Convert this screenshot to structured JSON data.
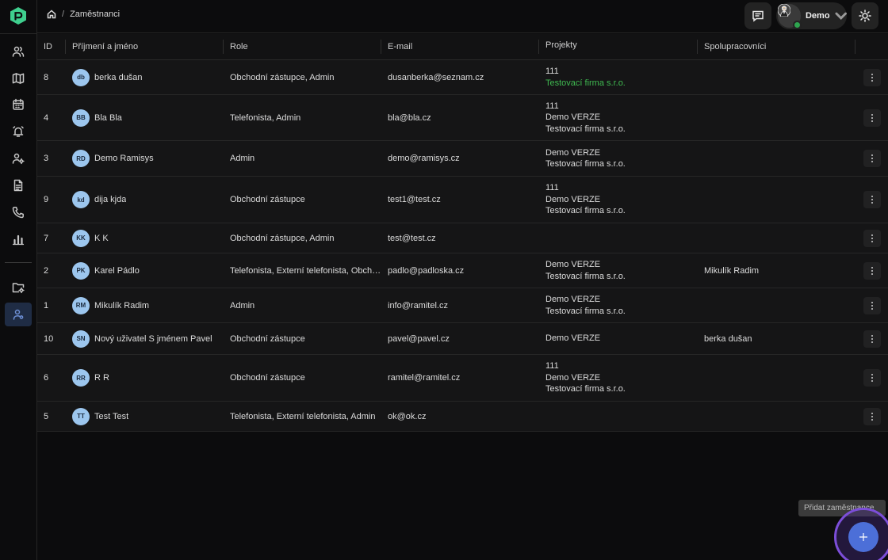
{
  "breadcrumb": {
    "page": "Zaměstnanci",
    "separator": "/"
  },
  "user": {
    "name": "Demo"
  },
  "sidebar": {
    "items": [
      {
        "icon": "users-icon"
      },
      {
        "icon": "map-icon"
      },
      {
        "icon": "calendar-icon"
      },
      {
        "icon": "alarm-icon"
      },
      {
        "icon": "user-cog-icon"
      },
      {
        "icon": "document-icon"
      },
      {
        "icon": "phone-icon"
      },
      {
        "icon": "bar-chart-icon"
      },
      {
        "icon": "folder-settings-icon"
      },
      {
        "icon": "employees-icon",
        "active": true
      }
    ]
  },
  "table": {
    "headers": {
      "id": "ID",
      "name": "Příjmení a jméno",
      "role": "Role",
      "email": "E-mail",
      "projects": "Projekty",
      "collaborators": "Spolupracovníci"
    },
    "rows": [
      {
        "id": "8",
        "initials": "db",
        "name": "berka dušan",
        "role": "Obchodní zástupce, Admin",
        "email": "dusanberka@seznam.cz",
        "projects": [
          "111",
          "Testovací firma s.r.o."
        ],
        "collaborators": ""
      },
      {
        "id": "4",
        "initials": "BB",
        "name": "Bla Bla",
        "role": "Telefonista, Admin",
        "email": "bla@bla.cz",
        "projects": [
          "111",
          "Demo VERZE",
          "Testovací firma s.r.o."
        ],
        "collaborators": ""
      },
      {
        "id": "3",
        "initials": "RD",
        "name": "Demo Ramisys",
        "role": "Admin",
        "email": "demo@ramisys.cz",
        "projects": [
          "Demo VERZE",
          "Testovací firma s.r.o."
        ],
        "collaborators": ""
      },
      {
        "id": "9",
        "initials": "kd",
        "name": "dija kjda",
        "role": "Obchodní zástupce",
        "email": "test1@test.cz",
        "projects": [
          "111",
          "Demo VERZE",
          "Testovací firma s.r.o."
        ],
        "collaborators": ""
      },
      {
        "id": "7",
        "initials": "KK",
        "name": "K K",
        "role": "Obchodní zástupce, Admin",
        "email": "test@test.cz",
        "projects": [],
        "collaborators": ""
      },
      {
        "id": "2",
        "initials": "PK",
        "name": "Karel Pádlo",
        "role": "Telefonista, Externí telefonista, Obchodní zástupce",
        "email": "padlo@padloska.cz",
        "projects": [
          "Demo VERZE",
          "Testovací firma s.r.o."
        ],
        "collaborators": "Mikulík Radim"
      },
      {
        "id": "1",
        "initials": "RM",
        "name": "Mikulík Radim",
        "role": "Admin",
        "email": "info@ramitel.cz",
        "projects": [
          "Demo VERZE",
          "Testovací firma s.r.o."
        ],
        "collaborators": ""
      },
      {
        "id": "10",
        "initials": "SN",
        "name": "Nový uživatel S jménem Pavel",
        "role": "Obchodní zástupce",
        "email": "pavel@pavel.cz",
        "projects": [
          "Demo VERZE"
        ],
        "collaborators": "berka dušan"
      },
      {
        "id": "6",
        "initials": "RR",
        "name": "R R",
        "role": "Obchodní zástupce",
        "email": "ramitel@ramitel.cz",
        "projects": [
          "111",
          "Demo VERZE",
          "Testovací firma s.r.o."
        ],
        "collaborators": ""
      },
      {
        "id": "5",
        "initials": "TT",
        "name": "Test Test",
        "role": "Telefonista, Externí telefonista, Admin",
        "email": "ok@ok.cz",
        "projects": [],
        "collaborators": ""
      }
    ]
  },
  "fab": {
    "tooltip": "Přidat zaměstnance"
  },
  "colors": {
    "accent": "#4c6fd8",
    "highlight_green": "#3fb950",
    "avatar_bg": "#9cc6ee"
  }
}
